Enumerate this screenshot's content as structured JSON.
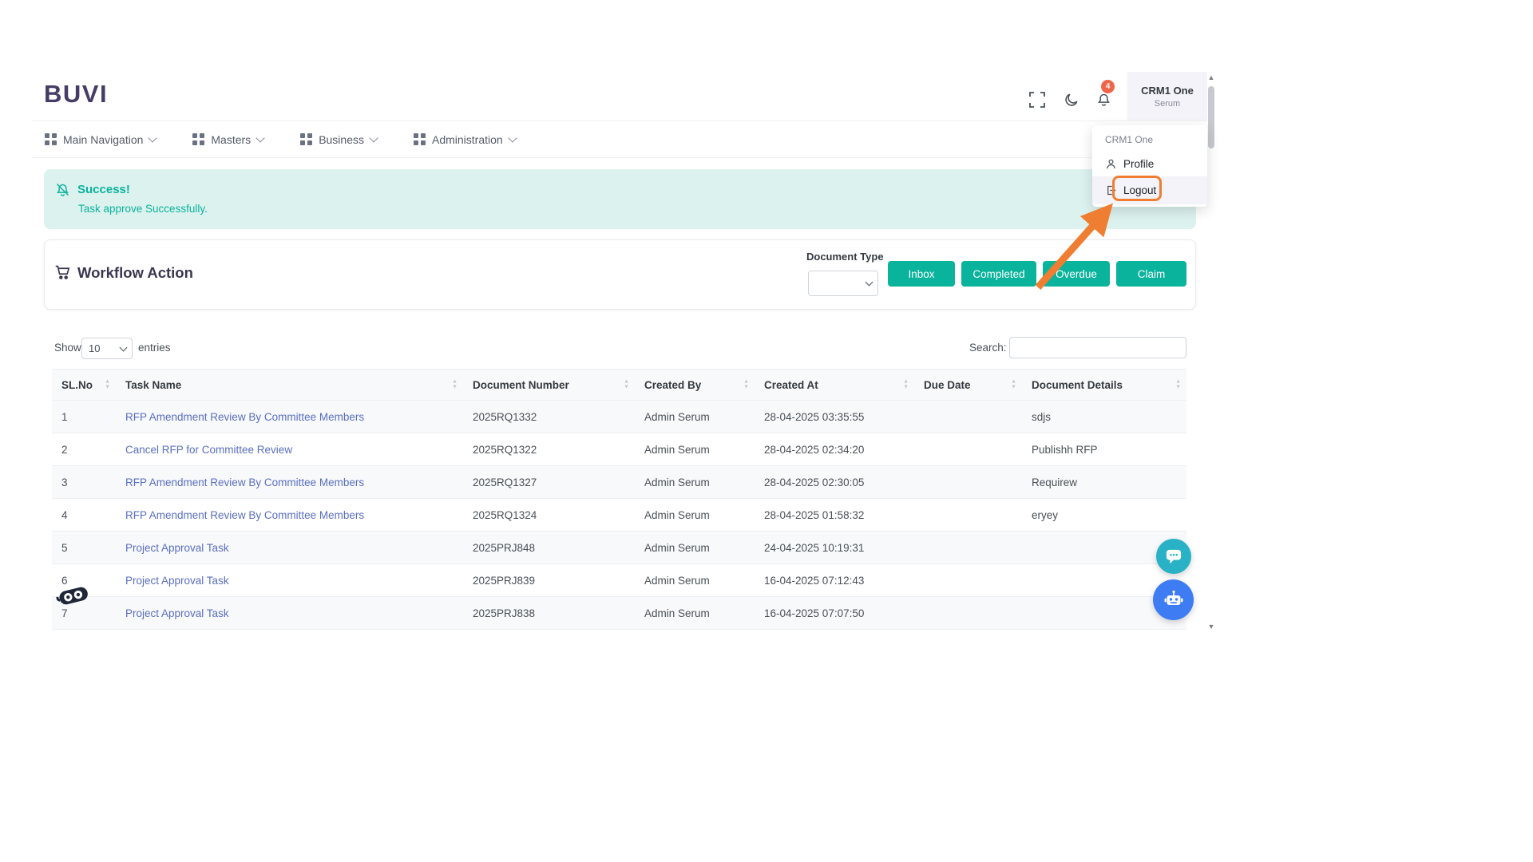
{
  "header": {
    "logo_text": "BUVI",
    "notification_badge": "4",
    "user_name": "CRM1 One",
    "user_role": "Serum"
  },
  "nav": {
    "items": [
      {
        "label": "Main Navigation"
      },
      {
        "label": "Masters"
      },
      {
        "label": "Business"
      },
      {
        "label": "Administration"
      }
    ]
  },
  "user_menu": {
    "header": "CRM1 One",
    "profile_label": "Profile",
    "logout_label": "Logout"
  },
  "alert": {
    "title": "Success!",
    "message": "Task approve Successfully."
  },
  "workflow": {
    "title": "Workflow Action",
    "document_type_label": "Document Type",
    "buttons": [
      {
        "label": "Inbox"
      },
      {
        "label": "Completed"
      },
      {
        "label": "Overdue"
      },
      {
        "label": "Claim"
      }
    ]
  },
  "controls": {
    "show_label": "Show",
    "page_size": "10",
    "entries_label": "entries",
    "search_label": "Search:"
  },
  "table": {
    "columns": [
      {
        "label": "SL.No"
      },
      {
        "label": "Task Name"
      },
      {
        "label": "Document Number"
      },
      {
        "label": "Created By"
      },
      {
        "label": "Created At"
      },
      {
        "label": "Due Date"
      },
      {
        "label": "Document Details"
      }
    ],
    "rows": [
      {
        "sl": "1",
        "task": "RFP Amendment Review By Committee Members",
        "doc_number": "2025RQ1332",
        "created_by": "Admin Serum",
        "created_at": "28-04-2025 03:35:55",
        "due_date": "",
        "details": "sdjs"
      },
      {
        "sl": "2",
        "task": "Cancel RFP for Committee Review",
        "doc_number": "2025RQ1322",
        "created_by": "Admin Serum",
        "created_at": "28-04-2025 02:34:20",
        "due_date": "",
        "details": "Publishh RFP"
      },
      {
        "sl": "3",
        "task": "RFP Amendment Review By Committee Members",
        "doc_number": "2025RQ1327",
        "created_by": "Admin Serum",
        "created_at": "28-04-2025 02:30:05",
        "due_date": "",
        "details": "Requirew"
      },
      {
        "sl": "4",
        "task": "RFP Amendment Review By Committee Members",
        "doc_number": "2025RQ1324",
        "created_by": "Admin Serum",
        "created_at": "28-04-2025 01:58:32",
        "due_date": "",
        "details": "eryey"
      },
      {
        "sl": "5",
        "task": "Project Approval Task",
        "doc_number": "2025PRJ848",
        "created_by": "Admin Serum",
        "created_at": "24-04-2025 10:19:31",
        "due_date": "",
        "details": ""
      },
      {
        "sl": "6",
        "task": "Project Approval Task",
        "doc_number": "2025PRJ839",
        "created_by": "Admin Serum",
        "created_at": "16-04-2025 07:12:43",
        "due_date": "",
        "details": ""
      },
      {
        "sl": "7",
        "task": "Project Approval Task",
        "doc_number": "2025PRJ838",
        "created_by": "Admin Serum",
        "created_at": "16-04-2025 07:07:50",
        "due_date": "",
        "details": ""
      }
    ]
  },
  "colors": {
    "accent": "#0ab39c",
    "link": "#5a6fc0",
    "badge": "#f06548",
    "annotation": "#ef7e32",
    "logo": "#463c66"
  }
}
